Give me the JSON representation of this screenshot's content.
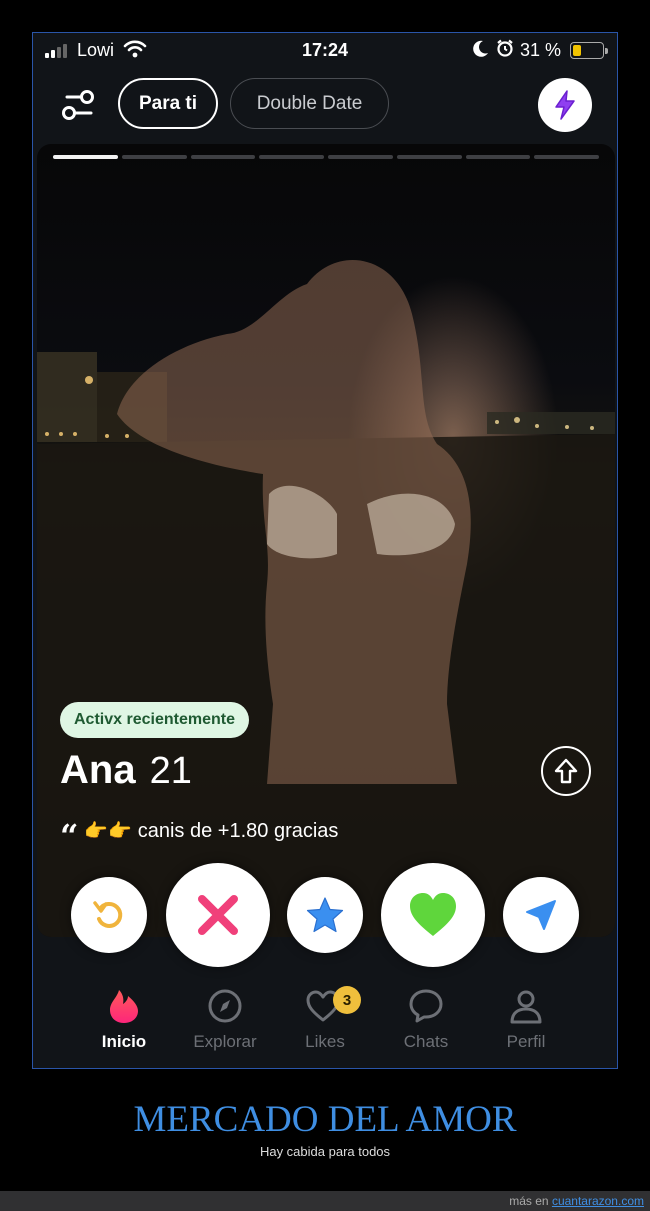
{
  "status_bar": {
    "carrier": "Lowi",
    "time": "17:24",
    "battery_percent": "31 %",
    "battery_level": 0.31,
    "battery_color": "#f2c400"
  },
  "header": {
    "tabs": [
      {
        "label": "Para ti",
        "active": true
      },
      {
        "label": "Double Date",
        "active": false
      }
    ],
    "filter_icon": "sliders-icon",
    "boost_icon": "lightning-bolt-icon",
    "boost_color": "#8f3ff0"
  },
  "card": {
    "photo_count": 8,
    "current_photo": 1,
    "activity_badge": "Activx recientemente",
    "name": "Ana",
    "age": "21",
    "bio_emoji": "👉👉",
    "bio": "canis de +1.80 gracias",
    "info_icon": "arrow-up-icon"
  },
  "actions": [
    {
      "name": "rewind",
      "icon": "rewind-icon",
      "color": "#f0b43c"
    },
    {
      "name": "nope",
      "icon": "x-icon",
      "color": "#f0407a"
    },
    {
      "name": "super-like",
      "icon": "star-icon",
      "color": "#3a8ff0"
    },
    {
      "name": "like",
      "icon": "heart-icon",
      "color": "#5fd63c"
    },
    {
      "name": "boost",
      "icon": "send-icon",
      "color": "#3a8ff0"
    }
  ],
  "nav": {
    "items": [
      {
        "label": "Inicio",
        "icon": "flame-icon",
        "active": true
      },
      {
        "label": "Explorar",
        "icon": "compass-icon",
        "active": false
      },
      {
        "label": "Likes",
        "icon": "hearts-icon",
        "active": false,
        "badge": "3"
      },
      {
        "label": "Chats",
        "icon": "chat-bubble-icon",
        "active": false
      },
      {
        "label": "Perfil",
        "icon": "person-icon",
        "active": false
      }
    ]
  },
  "caption": {
    "title": "MERCADO DEL AMOR",
    "subtitle": "Hay cabida para todos",
    "footer_prefix": "más en",
    "footer_link": "cuantarazon.com"
  }
}
